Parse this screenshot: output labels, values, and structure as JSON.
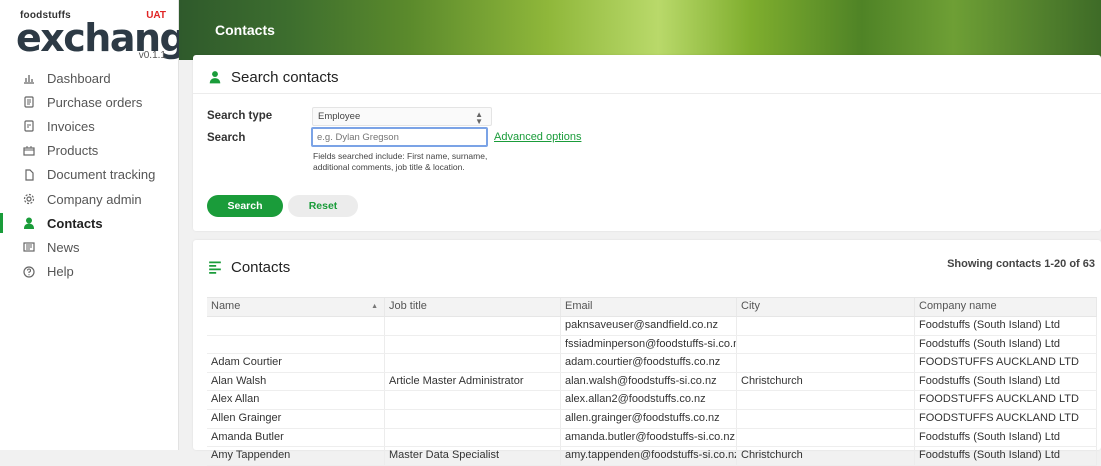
{
  "brand": {
    "top": "foodstuffs",
    "name": "exchange",
    "env": "UAT",
    "version": "v0.1.1"
  },
  "nav": [
    {
      "label": "Dashboard",
      "icon": "chart-icon"
    },
    {
      "label": "Purchase orders",
      "icon": "document-icon"
    },
    {
      "label": "Invoices",
      "icon": "invoice-icon"
    },
    {
      "label": "Products",
      "icon": "products-icon"
    },
    {
      "label": "Document tracking",
      "icon": "file-icon"
    },
    {
      "label": "Company admin",
      "icon": "gear-icon"
    },
    {
      "label": "Contacts",
      "icon": "person-icon",
      "active": true
    },
    {
      "label": "News",
      "icon": "news-icon"
    },
    {
      "label": "Help",
      "icon": "help-icon"
    }
  ],
  "header": {
    "title": "Contacts"
  },
  "search_card": {
    "title": "Search contacts",
    "search_type_label": "Search type",
    "search_type_value": "Employee",
    "search_label": "Search",
    "search_placeholder": "e.g. Dylan Gregson",
    "advanced_options": "Advanced options",
    "hint": "Fields searched include: First name, surname, additional comments, job title & location.",
    "search_button": "Search",
    "reset_button": "Reset"
  },
  "contacts_card": {
    "title": "Contacts",
    "showing": "Showing contacts 1-20 of 63",
    "columns": [
      "Name",
      "Job title",
      "Email",
      "City",
      "Company name"
    ],
    "rows": [
      [
        "",
        "",
        "paknsaveuser@sandfield.co.nz",
        "",
        "Foodstuffs (South Island) Ltd"
      ],
      [
        "",
        "",
        "fssiadminperson@foodstuffs-si.co.nz",
        "",
        "Foodstuffs (South Island) Ltd"
      ],
      [
        "Adam Courtier",
        "",
        "adam.courtier@foodstuffs.co.nz",
        "",
        "FOODSTUFFS AUCKLAND LTD"
      ],
      [
        "Alan Walsh",
        "Article Master Administrator",
        "alan.walsh@foodstuffs-si.co.nz",
        "Christchurch",
        "Foodstuffs (South Island) Ltd"
      ],
      [
        "Alex Allan",
        "",
        "alex.allan2@foodstuffs.co.nz",
        "",
        "FOODSTUFFS AUCKLAND LTD"
      ],
      [
        "Allen Grainger",
        "",
        "allen.grainger@foodstuffs.co.nz",
        "",
        "FOODSTUFFS AUCKLAND LTD"
      ],
      [
        "Amanda Butler",
        "",
        "amanda.butler@foodstuffs-si.co.nz",
        "",
        "Foodstuffs (South Island) Ltd"
      ],
      [
        "Amy Tappenden",
        "Master Data Specialist",
        "amy.tappenden@foodstuffs-si.co.nz",
        "Christchurch",
        "Foodstuffs (South Island) Ltd"
      ]
    ]
  },
  "colors": {
    "accent": "#1a9c3a",
    "input_focus": "#7ba3e6"
  }
}
